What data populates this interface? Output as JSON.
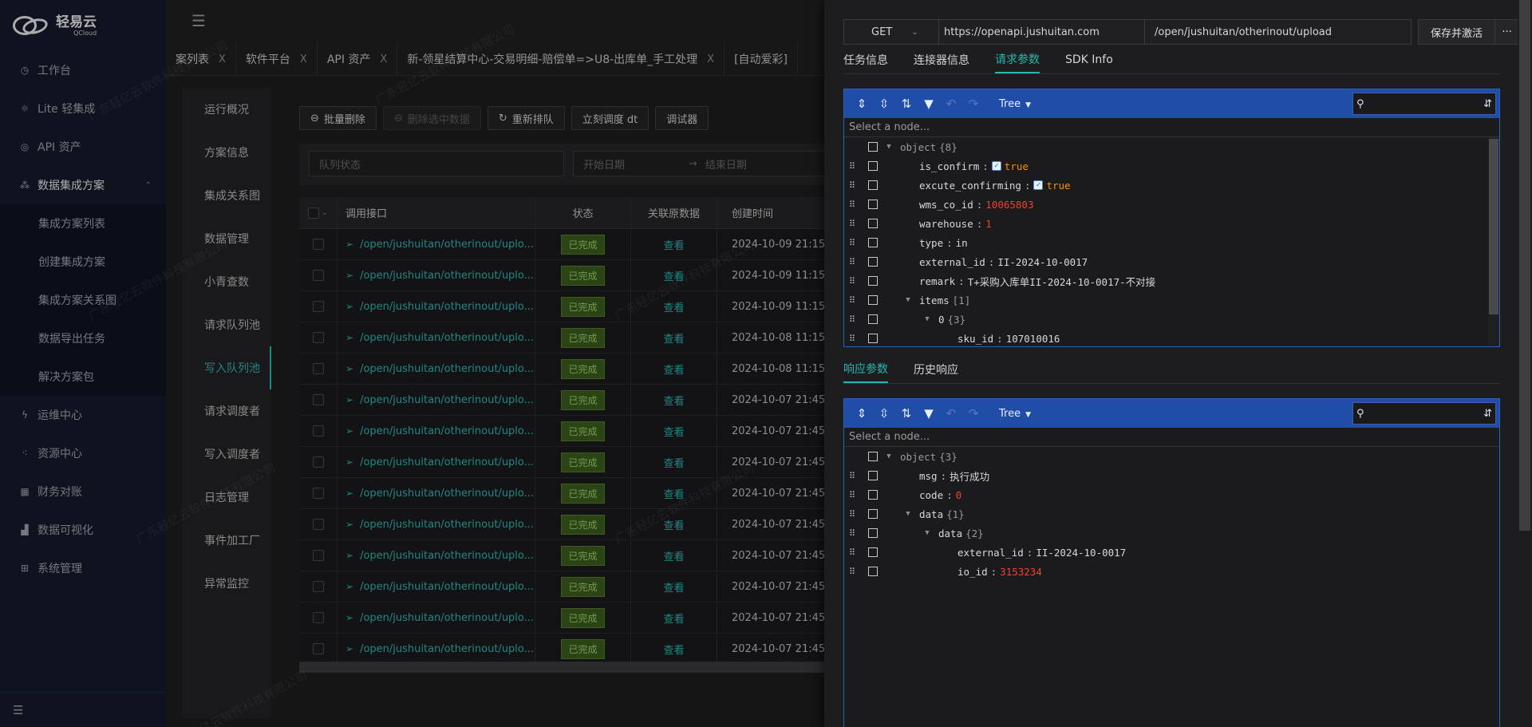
{
  "logo": {
    "name": "轻易云",
    "sub": "QCloud"
  },
  "sidebar": {
    "items": [
      {
        "label": "工作台",
        "icon": "clock-icon"
      },
      {
        "label": "Lite 轻集成",
        "icon": "bulb-icon"
      },
      {
        "label": "API 资产",
        "icon": "compass-icon"
      },
      {
        "label": "数据集成方案",
        "icon": "share-icon",
        "open": true
      }
    ],
    "subitems": [
      {
        "label": "集成方案列表"
      },
      {
        "label": "创建集成方案"
      },
      {
        "label": "集成方案关系图"
      },
      {
        "label": "数据导出任务"
      },
      {
        "label": "解决方案包"
      }
    ],
    "items2": [
      {
        "label": "运维中心",
        "icon": "bolt-icon"
      },
      {
        "label": "资源中心",
        "icon": "cluster-icon"
      },
      {
        "label": "财务对账",
        "icon": "calc-icon"
      },
      {
        "label": "数据可视化",
        "icon": "chart-icon"
      },
      {
        "label": "系统管理",
        "icon": "grid-icon"
      }
    ]
  },
  "tabs": [
    {
      "label": "案列表"
    },
    {
      "label": "软件平台"
    },
    {
      "label": "API 资产"
    },
    {
      "label": "新-领星结算中心-交易明细-赔偿单=>U8-出库单_手工处理"
    },
    {
      "label": "[自动爱彩]"
    }
  ],
  "subnav": [
    "运行概况",
    "方案信息",
    "集成关系图",
    "数据管理",
    "小青查数",
    "请求队列池",
    "写入队列池",
    "请求调度者",
    "写入调度者",
    "日志管理",
    "事件加工厂",
    "异常监控"
  ],
  "toolbar": {
    "batch_delete": "批量删除",
    "delete_selected": "删除选中数据",
    "requeue": "重新排队",
    "dispatch": "立刻调度 dt",
    "debugger": "调试器"
  },
  "filters": {
    "queue_status": "队列状态",
    "start_date": "开始日期",
    "end_date": "结束日期",
    "arrow": "→"
  },
  "table": {
    "headers": [
      "调用接口",
      "状态",
      "关联原数据",
      "创建时间"
    ],
    "rows": [
      {
        "api": "/open/jushuitan/otherinout/uplo...",
        "status": "已完成",
        "view": "查看",
        "time": "2024-10-09 21:15:"
      },
      {
        "api": "/open/jushuitan/otherinout/uplo...",
        "status": "已完成",
        "view": "查看",
        "time": "2024-10-09 11:15:"
      },
      {
        "api": "/open/jushuitan/otherinout/uplo...",
        "status": "已完成",
        "view": "查看",
        "time": "2024-10-09 11:15:"
      },
      {
        "api": "/open/jushuitan/otherinout/uplo...",
        "status": "已完成",
        "view": "查看",
        "time": "2024-10-08 11:15:"
      },
      {
        "api": "/open/jushuitan/otherinout/uplo...",
        "status": "已完成",
        "view": "查看",
        "time": "2024-10-08 11:15:"
      },
      {
        "api": "/open/jushuitan/otherinout/uplo...",
        "status": "已完成",
        "view": "查看",
        "time": "2024-10-07 21:45:"
      },
      {
        "api": "/open/jushuitan/otherinout/uplo...",
        "status": "已完成",
        "view": "查看",
        "time": "2024-10-07 21:45:"
      },
      {
        "api": "/open/jushuitan/otherinout/uplo...",
        "status": "已完成",
        "view": "查看",
        "time": "2024-10-07 21:45:"
      },
      {
        "api": "/open/jushuitan/otherinout/uplo...",
        "status": "已完成",
        "view": "查看",
        "time": "2024-10-07 21:45:"
      },
      {
        "api": "/open/jushuitan/otherinout/uplo...",
        "status": "已完成",
        "view": "查看",
        "time": "2024-10-07 21:45:"
      },
      {
        "api": "/open/jushuitan/otherinout/uplo...",
        "status": "已完成",
        "view": "查看",
        "time": "2024-10-07 21:45:"
      },
      {
        "api": "/open/jushuitan/otherinout/uplo...",
        "status": "已完成",
        "view": "查看",
        "time": "2024-10-07 21:45:"
      },
      {
        "api": "/open/jushuitan/otherinout/uplo...",
        "status": "已完成",
        "view": "查看",
        "time": "2024-10-07 21:45:"
      },
      {
        "api": "/open/jushuitan/otherinout/uplo...",
        "status": "已完成",
        "view": "查看",
        "time": "2024-10-07 21:45:"
      }
    ]
  },
  "drawer": {
    "method": "GET",
    "base_url": "https://openapi.jushuitan.com",
    "path": "/open/jushuitan/otherinout/upload",
    "save_label": "保存并激活",
    "more_label": "···",
    "tabs": [
      "任务信息",
      "连接器信息",
      "请求参数",
      "SDK Info"
    ],
    "active_tab": "请求参数",
    "resp_tabs": [
      "响应参数",
      "历史响应"
    ],
    "active_resp_tab": "响应参数"
  },
  "editor": {
    "mode": "Tree",
    "nav_placeholder": "Select a node..."
  },
  "request_tree": [
    {
      "depth": 0,
      "expander": "▼",
      "key": "object",
      "type": "{8}",
      "root": true
    },
    {
      "depth": 1,
      "key": "is_confirm",
      "value": "true",
      "kind": "bool"
    },
    {
      "depth": 1,
      "key": "excute_confirming",
      "value": "true",
      "kind": "bool"
    },
    {
      "depth": 1,
      "key": "wms_co_id",
      "value": "10065803",
      "kind": "num"
    },
    {
      "depth": 1,
      "key": "warehouse",
      "value": "1",
      "kind": "num"
    },
    {
      "depth": 1,
      "key": "type",
      "value": "in",
      "kind": "str"
    },
    {
      "depth": 1,
      "key": "external_id",
      "value": "II-2024-10-0017",
      "kind": "str"
    },
    {
      "depth": 1,
      "key": "remark",
      "value": "T+采购入库单II-2024-10-0017-不对接",
      "kind": "str"
    },
    {
      "depth": 1,
      "expander": "▼",
      "key": "items",
      "type": "[1]"
    },
    {
      "depth": 2,
      "expander": "▼",
      "key": "0",
      "type": "{3}"
    },
    {
      "depth": 3,
      "key": "sku_id",
      "value": "107010016",
      "kind": "str"
    }
  ],
  "response_tree": [
    {
      "depth": 0,
      "expander": "▼",
      "key": "object",
      "type": "{3}",
      "root": true
    },
    {
      "depth": 1,
      "key": "msg",
      "value": "执行成功",
      "kind": "str"
    },
    {
      "depth": 1,
      "key": "code",
      "value": "0",
      "kind": "num"
    },
    {
      "depth": 1,
      "expander": "▼",
      "key": "data",
      "type": "{1}"
    },
    {
      "depth": 2,
      "expander": "▼",
      "key": "data",
      "type": "{2}"
    },
    {
      "depth": 3,
      "key": "external_id",
      "value": "II-2024-10-0017",
      "kind": "str"
    },
    {
      "depth": 3,
      "key": "io_id",
      "value": "3153234",
      "kind": "num"
    }
  ],
  "watermark": "广东轻亿云软件科技有限公司",
  "colors": {
    "accent": "#2bb5b0",
    "editor_blue": "#1f4da8",
    "num": "#ee422e",
    "bool": "#ff8c00"
  }
}
